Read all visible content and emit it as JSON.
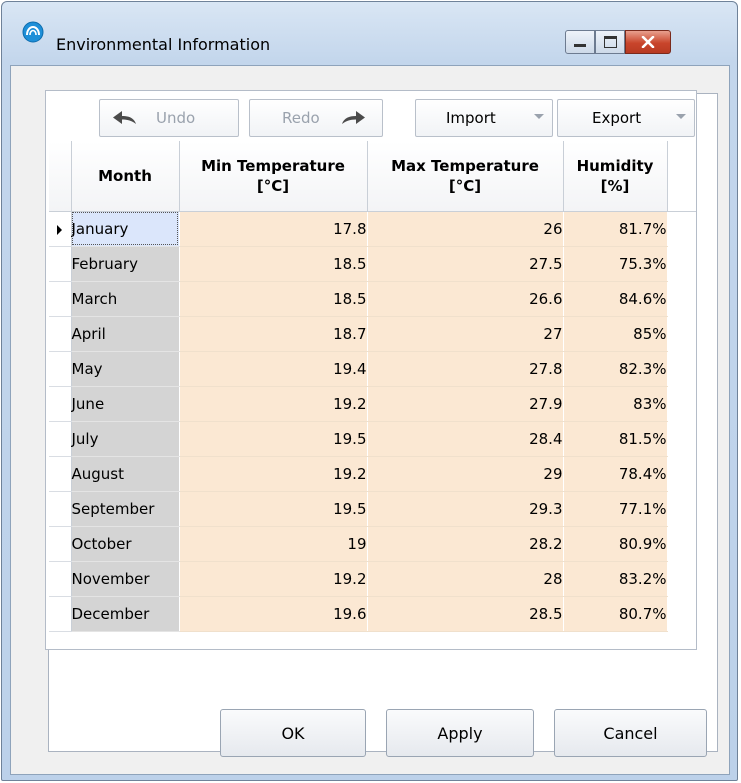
{
  "window": {
    "title": "Environmental Information"
  },
  "toolbar": {
    "undo": "Undo",
    "redo": "Redo",
    "import": "Import",
    "export": "Export"
  },
  "grid": {
    "headers": {
      "month": "Month",
      "min_temp": [
        "Min Temperature",
        "[°C]"
      ],
      "max_temp": [
        "Max Temperature",
        "[°C]"
      ],
      "humidity": [
        "Humidity",
        "[%]"
      ]
    },
    "rows": [
      {
        "month": "January",
        "min": "17.8",
        "max": "26",
        "hum": "81.7%"
      },
      {
        "month": "February",
        "min": "18.5",
        "max": "27.5",
        "hum": "75.3%"
      },
      {
        "month": "March",
        "min": "18.5",
        "max": "26.6",
        "hum": "84.6%"
      },
      {
        "month": "April",
        "min": "18.7",
        "max": "27",
        "hum": "85%"
      },
      {
        "month": "May",
        "min": "19.4",
        "max": "27.8",
        "hum": "82.3%"
      },
      {
        "month": "June",
        "min": "19.2",
        "max": "27.9",
        "hum": "83%"
      },
      {
        "month": "July",
        "min": "19.5",
        "max": "28.4",
        "hum": "81.5%"
      },
      {
        "month": "August",
        "min": "19.2",
        "max": "29",
        "hum": "78.4%"
      },
      {
        "month": "September",
        "min": "19.5",
        "max": "29.3",
        "hum": "77.1%"
      },
      {
        "month": "October",
        "min": "19",
        "max": "28.2",
        "hum": "80.9%"
      },
      {
        "month": "November",
        "min": "19.2",
        "max": "28",
        "hum": "83.2%"
      },
      {
        "month": "December",
        "min": "19.6",
        "max": "28.5",
        "hum": "80.7%"
      }
    ]
  },
  "buttons": {
    "ok": "OK",
    "apply": "Apply",
    "cancel": "Cancel"
  },
  "colors": {
    "row_header": "#d4d4d4",
    "cell": "#fbe8d3",
    "active_cell": "#dbe6fb"
  }
}
